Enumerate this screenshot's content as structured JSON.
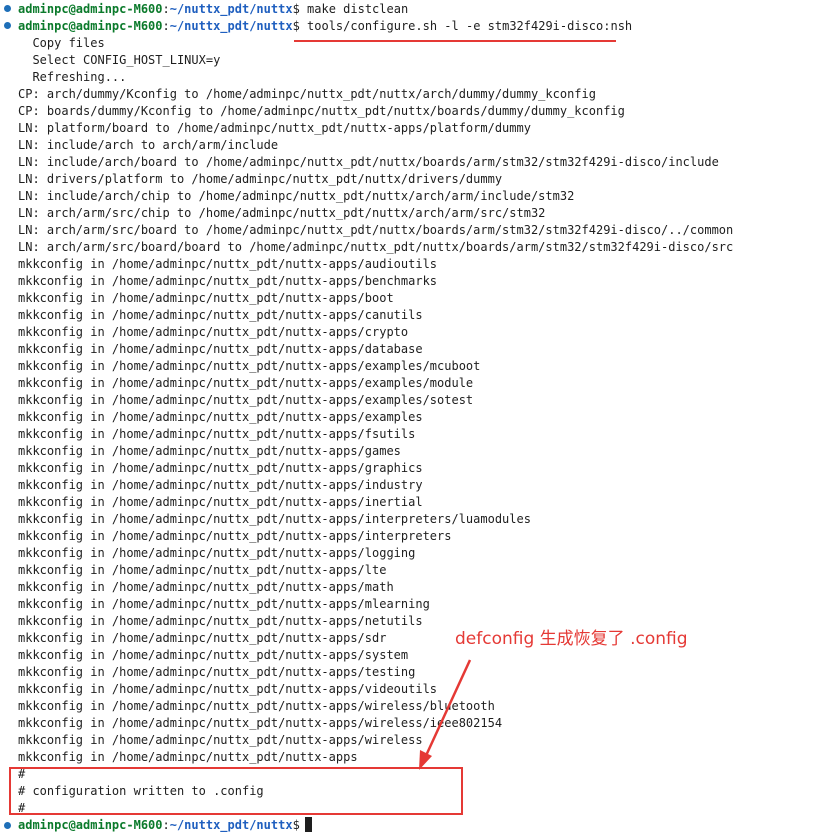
{
  "prompt": {
    "user_host": "adminpc@adminpc-M600",
    "sep": ":",
    "path": "~/nuttx_pdt/nuttx",
    "symbol": "$"
  },
  "commands": [
    "make distclean",
    "tools/configure.sh -l -e stm32f429i-disco:nsh"
  ],
  "output_lines": [
    "  Copy files",
    "  Select CONFIG_HOST_LINUX=y",
    "  Refreshing...",
    "CP: arch/dummy/Kconfig to /home/adminpc/nuttx_pdt/nuttx/arch/dummy/dummy_kconfig",
    "CP: boards/dummy/Kconfig to /home/adminpc/nuttx_pdt/nuttx/boards/dummy/dummy_kconfig",
    "LN: platform/board to /home/adminpc/nuttx_pdt/nuttx-apps/platform/dummy",
    "LN: include/arch to arch/arm/include",
    "LN: include/arch/board to /home/adminpc/nuttx_pdt/nuttx/boards/arm/stm32/stm32f429i-disco/include",
    "LN: drivers/platform to /home/adminpc/nuttx_pdt/nuttx/drivers/dummy",
    "LN: include/arch/chip to /home/adminpc/nuttx_pdt/nuttx/arch/arm/include/stm32",
    "LN: arch/arm/src/chip to /home/adminpc/nuttx_pdt/nuttx/arch/arm/src/stm32",
    "LN: arch/arm/src/board to /home/adminpc/nuttx_pdt/nuttx/boards/arm/stm32/stm32f429i-disco/../common",
    "LN: arch/arm/src/board/board to /home/adminpc/nuttx_pdt/nuttx/boards/arm/stm32/stm32f429i-disco/src",
    "mkkconfig in /home/adminpc/nuttx_pdt/nuttx-apps/audioutils",
    "mkkconfig in /home/adminpc/nuttx_pdt/nuttx-apps/benchmarks",
    "mkkconfig in /home/adminpc/nuttx_pdt/nuttx-apps/boot",
    "mkkconfig in /home/adminpc/nuttx_pdt/nuttx-apps/canutils",
    "mkkconfig in /home/adminpc/nuttx_pdt/nuttx-apps/crypto",
    "mkkconfig in /home/adminpc/nuttx_pdt/nuttx-apps/database",
    "mkkconfig in /home/adminpc/nuttx_pdt/nuttx-apps/examples/mcuboot",
    "mkkconfig in /home/adminpc/nuttx_pdt/nuttx-apps/examples/module",
    "mkkconfig in /home/adminpc/nuttx_pdt/nuttx-apps/examples/sotest",
    "mkkconfig in /home/adminpc/nuttx_pdt/nuttx-apps/examples",
    "mkkconfig in /home/adminpc/nuttx_pdt/nuttx-apps/fsutils",
    "mkkconfig in /home/adminpc/nuttx_pdt/nuttx-apps/games",
    "mkkconfig in /home/adminpc/nuttx_pdt/nuttx-apps/graphics",
    "mkkconfig in /home/adminpc/nuttx_pdt/nuttx-apps/industry",
    "mkkconfig in /home/adminpc/nuttx_pdt/nuttx-apps/inertial",
    "mkkconfig in /home/adminpc/nuttx_pdt/nuttx-apps/interpreters/luamodules",
    "mkkconfig in /home/adminpc/nuttx_pdt/nuttx-apps/interpreters",
    "mkkconfig in /home/adminpc/nuttx_pdt/nuttx-apps/logging",
    "mkkconfig in /home/adminpc/nuttx_pdt/nuttx-apps/lte",
    "mkkconfig in /home/adminpc/nuttx_pdt/nuttx-apps/math",
    "mkkconfig in /home/adminpc/nuttx_pdt/nuttx-apps/mlearning",
    "mkkconfig in /home/adminpc/nuttx_pdt/nuttx-apps/netutils",
    "mkkconfig in /home/adminpc/nuttx_pdt/nuttx-apps/sdr",
    "mkkconfig in /home/adminpc/nuttx_pdt/nuttx-apps/system",
    "mkkconfig in /home/adminpc/nuttx_pdt/nuttx-apps/testing",
    "mkkconfig in /home/adminpc/nuttx_pdt/nuttx-apps/videoutils",
    "mkkconfig in /home/adminpc/nuttx_pdt/nuttx-apps/wireless/bluetooth",
    "mkkconfig in /home/adminpc/nuttx_pdt/nuttx-apps/wireless/ieee802154",
    "mkkconfig in /home/adminpc/nuttx_pdt/nuttx-apps/wireless",
    "mkkconfig in /home/adminpc/nuttx_pdt/nuttx-apps"
  ],
  "config_lines": [
    "#",
    "# configuration written to .config",
    "#"
  ],
  "annotation": "defconfig 生成恢复了 .config",
  "colors": {
    "user": "#0b7a2b",
    "path": "#1f5fbf",
    "annotation": "#e53935",
    "text": "#1e1e1e"
  }
}
